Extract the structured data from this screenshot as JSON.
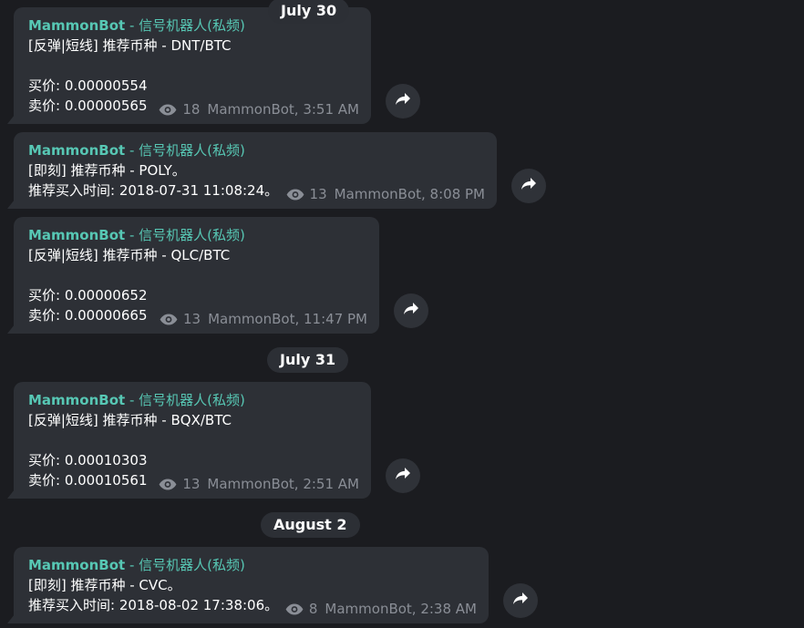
{
  "date_separators": [
    "July 30",
    "July 31",
    "August 2"
  ],
  "author": {
    "bot": "MammonBot",
    "sep": " - ",
    "channel": "信号机器人(私频)"
  },
  "messages": [
    {
      "lines": [
        "[反弹|短线] 推荐币种 - DNT/BTC",
        "",
        "买价: 0.00000554",
        "卖价: 0.00000565"
      ],
      "views": "18",
      "signature": "MammonBot, 3:51 AM"
    },
    {
      "lines": [
        "[即刻] 推荐币种 - POLY。",
        "推荐买入时间: 2018-07-31 11:08:24。"
      ],
      "views": "13",
      "signature": "MammonBot, 8:08 PM"
    },
    {
      "lines": [
        "[反弹|短线] 推荐币种 - QLC/BTC",
        "",
        "买价: 0.00000652",
        "卖价: 0.00000665"
      ],
      "views": "13",
      "signature": "MammonBot, 11:47 PM"
    },
    {
      "lines": [
        "[反弹|短线] 推荐币种 - BQX/BTC",
        "",
        "买价: 0.00010303",
        "卖价: 0.00010561"
      ],
      "views": "13",
      "signature": "MammonBot, 2:51 AM"
    },
    {
      "lines": [
        "[即刻] 推荐币种 - CVC。",
        "推荐买入时间: 2018-08-02 17:38:06。"
      ],
      "views": "8",
      "signature": "MammonBot, 2:38 AM"
    }
  ],
  "icons": {
    "views": "eye-icon",
    "forward": "share-arrow-icon"
  },
  "colors": {
    "background": "#1b1c20",
    "bubble": "#2d3036",
    "author": "#57c7b4",
    "meta": "#8a8e96"
  }
}
